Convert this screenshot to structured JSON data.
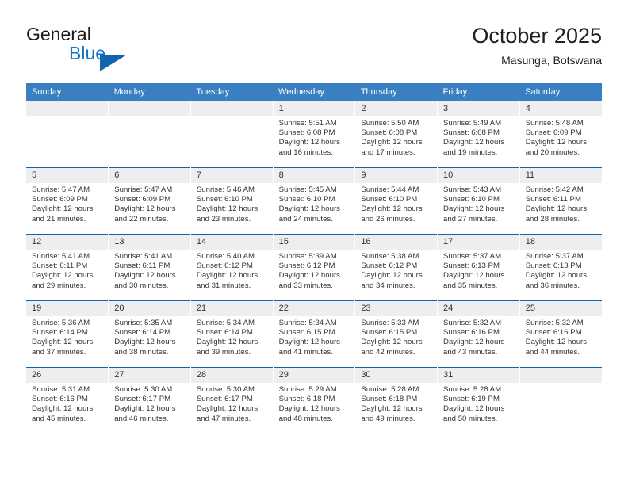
{
  "brand": {
    "name_part1": "General",
    "name_part2": "Blue",
    "triangle_color": "#1263ad",
    "blue_color": "#1277c4"
  },
  "header": {
    "title": "October 2025",
    "subtitle": "Masunga, Botswana"
  },
  "theme": {
    "header_row_bg": "#3a7fc1",
    "day_number_bg": "#eeeeee",
    "row_divider": "#1263ad",
    "text": "#333333"
  },
  "weekday_headers": [
    "Sunday",
    "Monday",
    "Tuesday",
    "Wednesday",
    "Thursday",
    "Friday",
    "Saturday"
  ],
  "weeks": [
    [
      {
        "day": "",
        "lines": []
      },
      {
        "day": "",
        "lines": []
      },
      {
        "day": "",
        "lines": []
      },
      {
        "day": "1",
        "lines": [
          "Sunrise: 5:51 AM",
          "Sunset: 6:08 PM",
          "Daylight: 12 hours",
          "and 16 minutes."
        ]
      },
      {
        "day": "2",
        "lines": [
          "Sunrise: 5:50 AM",
          "Sunset: 6:08 PM",
          "Daylight: 12 hours",
          "and 17 minutes."
        ]
      },
      {
        "day": "3",
        "lines": [
          "Sunrise: 5:49 AM",
          "Sunset: 6:08 PM",
          "Daylight: 12 hours",
          "and 19 minutes."
        ]
      },
      {
        "day": "4",
        "lines": [
          "Sunrise: 5:48 AM",
          "Sunset: 6:09 PM",
          "Daylight: 12 hours",
          "and 20 minutes."
        ]
      }
    ],
    [
      {
        "day": "5",
        "lines": [
          "Sunrise: 5:47 AM",
          "Sunset: 6:09 PM",
          "Daylight: 12 hours",
          "and 21 minutes."
        ]
      },
      {
        "day": "6",
        "lines": [
          "Sunrise: 5:47 AM",
          "Sunset: 6:09 PM",
          "Daylight: 12 hours",
          "and 22 minutes."
        ]
      },
      {
        "day": "7",
        "lines": [
          "Sunrise: 5:46 AM",
          "Sunset: 6:10 PM",
          "Daylight: 12 hours",
          "and 23 minutes."
        ]
      },
      {
        "day": "8",
        "lines": [
          "Sunrise: 5:45 AM",
          "Sunset: 6:10 PM",
          "Daylight: 12 hours",
          "and 24 minutes."
        ]
      },
      {
        "day": "9",
        "lines": [
          "Sunrise: 5:44 AM",
          "Sunset: 6:10 PM",
          "Daylight: 12 hours",
          "and 26 minutes."
        ]
      },
      {
        "day": "10",
        "lines": [
          "Sunrise: 5:43 AM",
          "Sunset: 6:10 PM",
          "Daylight: 12 hours",
          "and 27 minutes."
        ]
      },
      {
        "day": "11",
        "lines": [
          "Sunrise: 5:42 AM",
          "Sunset: 6:11 PM",
          "Daylight: 12 hours",
          "and 28 minutes."
        ]
      }
    ],
    [
      {
        "day": "12",
        "lines": [
          "Sunrise: 5:41 AM",
          "Sunset: 6:11 PM",
          "Daylight: 12 hours",
          "and 29 minutes."
        ]
      },
      {
        "day": "13",
        "lines": [
          "Sunrise: 5:41 AM",
          "Sunset: 6:11 PM",
          "Daylight: 12 hours",
          "and 30 minutes."
        ]
      },
      {
        "day": "14",
        "lines": [
          "Sunrise: 5:40 AM",
          "Sunset: 6:12 PM",
          "Daylight: 12 hours",
          "and 31 minutes."
        ]
      },
      {
        "day": "15",
        "lines": [
          "Sunrise: 5:39 AM",
          "Sunset: 6:12 PM",
          "Daylight: 12 hours",
          "and 33 minutes."
        ]
      },
      {
        "day": "16",
        "lines": [
          "Sunrise: 5:38 AM",
          "Sunset: 6:12 PM",
          "Daylight: 12 hours",
          "and 34 minutes."
        ]
      },
      {
        "day": "17",
        "lines": [
          "Sunrise: 5:37 AM",
          "Sunset: 6:13 PM",
          "Daylight: 12 hours",
          "and 35 minutes."
        ]
      },
      {
        "day": "18",
        "lines": [
          "Sunrise: 5:37 AM",
          "Sunset: 6:13 PM",
          "Daylight: 12 hours",
          "and 36 minutes."
        ]
      }
    ],
    [
      {
        "day": "19",
        "lines": [
          "Sunrise: 5:36 AM",
          "Sunset: 6:14 PM",
          "Daylight: 12 hours",
          "and 37 minutes."
        ]
      },
      {
        "day": "20",
        "lines": [
          "Sunrise: 5:35 AM",
          "Sunset: 6:14 PM",
          "Daylight: 12 hours",
          "and 38 minutes."
        ]
      },
      {
        "day": "21",
        "lines": [
          "Sunrise: 5:34 AM",
          "Sunset: 6:14 PM",
          "Daylight: 12 hours",
          "and 39 minutes."
        ]
      },
      {
        "day": "22",
        "lines": [
          "Sunrise: 5:34 AM",
          "Sunset: 6:15 PM",
          "Daylight: 12 hours",
          "and 41 minutes."
        ]
      },
      {
        "day": "23",
        "lines": [
          "Sunrise: 5:33 AM",
          "Sunset: 6:15 PM",
          "Daylight: 12 hours",
          "and 42 minutes."
        ]
      },
      {
        "day": "24",
        "lines": [
          "Sunrise: 5:32 AM",
          "Sunset: 6:16 PM",
          "Daylight: 12 hours",
          "and 43 minutes."
        ]
      },
      {
        "day": "25",
        "lines": [
          "Sunrise: 5:32 AM",
          "Sunset: 6:16 PM",
          "Daylight: 12 hours",
          "and 44 minutes."
        ]
      }
    ],
    [
      {
        "day": "26",
        "lines": [
          "Sunrise: 5:31 AM",
          "Sunset: 6:16 PM",
          "Daylight: 12 hours",
          "and 45 minutes."
        ]
      },
      {
        "day": "27",
        "lines": [
          "Sunrise: 5:30 AM",
          "Sunset: 6:17 PM",
          "Daylight: 12 hours",
          "and 46 minutes."
        ]
      },
      {
        "day": "28",
        "lines": [
          "Sunrise: 5:30 AM",
          "Sunset: 6:17 PM",
          "Daylight: 12 hours",
          "and 47 minutes."
        ]
      },
      {
        "day": "29",
        "lines": [
          "Sunrise: 5:29 AM",
          "Sunset: 6:18 PM",
          "Daylight: 12 hours",
          "and 48 minutes."
        ]
      },
      {
        "day": "30",
        "lines": [
          "Sunrise: 5:28 AM",
          "Sunset: 6:18 PM",
          "Daylight: 12 hours",
          "and 49 minutes."
        ]
      },
      {
        "day": "31",
        "lines": [
          "Sunrise: 5:28 AM",
          "Sunset: 6:19 PM",
          "Daylight: 12 hours",
          "and 50 minutes."
        ]
      },
      {
        "day": "",
        "lines": []
      }
    ]
  ]
}
